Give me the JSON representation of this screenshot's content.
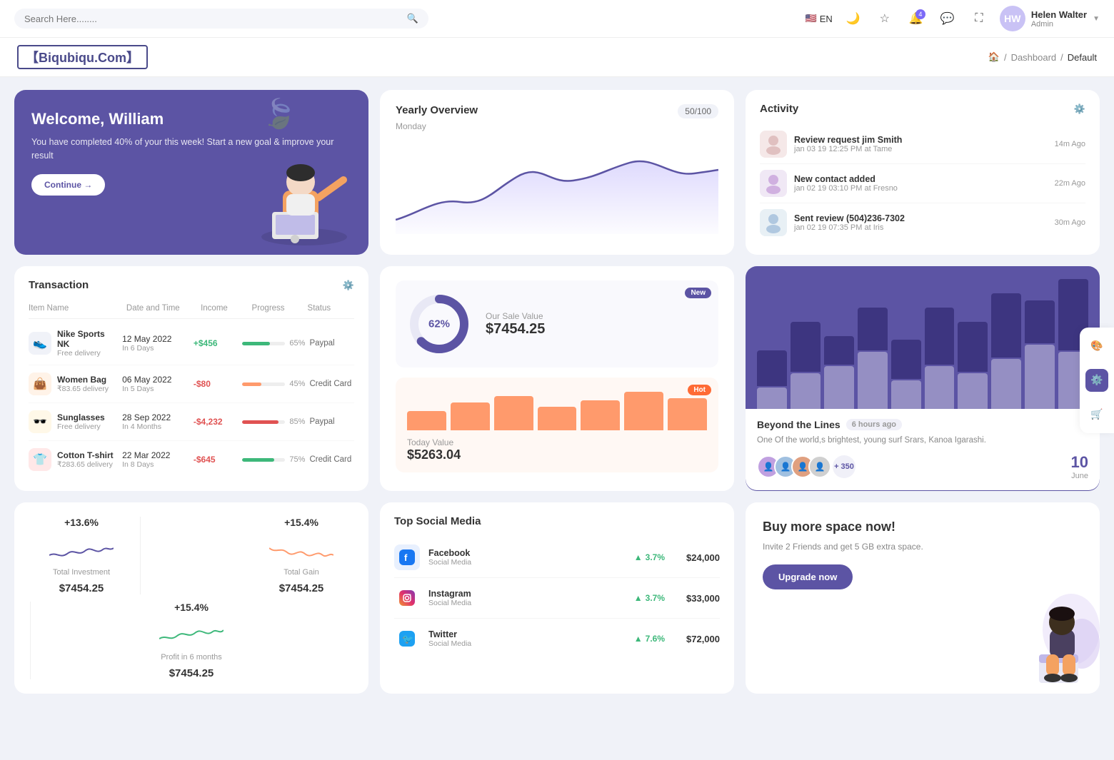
{
  "topnav": {
    "search_placeholder": "Search Here........",
    "lang": "EN",
    "user_name": "Helen Walter",
    "user_role": "Admin",
    "notification_count": "4"
  },
  "breadcrumb": {
    "brand": "【Biqubiqu.Com】",
    "home": "🏠",
    "dashboard": "Dashboard",
    "current": "Default"
  },
  "welcome": {
    "title": "Welcome, William",
    "subtitle": "You have completed 40% of your this week! Start a new goal & improve your result",
    "button": "Continue →"
  },
  "yearly": {
    "title": "Yearly Overview",
    "badge": "50/100",
    "subtitle": "Monday"
  },
  "activity": {
    "title": "Activity",
    "items": [
      {
        "name": "Review request jim Smith",
        "detail": "jan 03 19 12:25 PM at Tame",
        "ago": "14m Ago"
      },
      {
        "name": "New contact added",
        "detail": "jan 02 19 03:10 PM at Fresno",
        "ago": "22m Ago"
      },
      {
        "name": "Sent review (504)236-7302",
        "detail": "jan 02 19 07:35 PM at Iris",
        "ago": "30m Ago"
      }
    ]
  },
  "transaction": {
    "title": "Transaction",
    "headers": [
      "Item Name",
      "Date and Time",
      "Income",
      "Progress",
      "Status"
    ],
    "rows": [
      {
        "icon": "👟",
        "name": "Nike Sports NK",
        "sub": "Free delivery",
        "date": "12 May 2022",
        "date_sub": "In 6 Days",
        "income": "+$456",
        "income_type": "pos",
        "progress": 65,
        "progress_color": "#3db87a",
        "status": "Paypal"
      },
      {
        "icon": "👜",
        "name": "Women Bag",
        "sub": "₹83.65 delivery",
        "date": "06 May 2022",
        "date_sub": "In 5 Days",
        "income": "-$80",
        "income_type": "neg",
        "progress": 45,
        "progress_color": "#ff9a6c",
        "status": "Credit Card"
      },
      {
        "icon": "🕶️",
        "name": "Sunglasses",
        "sub": "Free delivery",
        "date": "28 Sep 2022",
        "date_sub": "In 4 Months",
        "income": "-$4,232",
        "income_type": "neg",
        "progress": 85,
        "progress_color": "#e05252",
        "status": "Paypal"
      },
      {
        "icon": "👕",
        "name": "Cotton T-shirt",
        "sub": "₹283.65 delivery",
        "date": "22 Mar 2022",
        "date_sub": "In 8 Days",
        "income": "-$645",
        "income_type": "neg",
        "progress": 75,
        "progress_color": "#3db87a",
        "status": "Credit Card"
      }
    ]
  },
  "sale_value": {
    "donut_pct": "62%",
    "label": "Our Sale Value",
    "value": "$7454.25",
    "badge": "New",
    "today_label": "Today Value",
    "today_value": "$5263.04",
    "hot_badge": "Hot",
    "today_bars": [
      30,
      45,
      55,
      40,
      50,
      60,
      50
    ]
  },
  "bar_chart": {
    "title": "Beyond the Lines",
    "time_ago": "6 hours ago",
    "desc": "One Of the world,s brightest, young surf Srars, Kanoa Igarashi.",
    "plus_count": "+ 350",
    "date_num": "10",
    "date_month": "June",
    "bars": [
      {
        "dark": 50,
        "light": 30
      },
      {
        "dark": 70,
        "light": 50
      },
      {
        "dark": 40,
        "light": 60
      },
      {
        "dark": 60,
        "light": 80
      },
      {
        "dark": 55,
        "light": 40
      },
      {
        "dark": 80,
        "light": 60
      },
      {
        "dark": 70,
        "light": 50
      },
      {
        "dark": 90,
        "light": 70
      },
      {
        "dark": 60,
        "light": 90
      },
      {
        "dark": 100,
        "light": 80
      }
    ]
  },
  "stats": {
    "items": [
      {
        "pct": "+13.6%",
        "label": "Total Investment",
        "value": "$7454.25",
        "color": "#5c54a4"
      },
      {
        "pct": "+15.4%",
        "label": "Total Gain",
        "value": "$7454.25",
        "color": "#ff9a6c"
      },
      {
        "pct": "+15.4%",
        "label": "Profit in 6 months",
        "value": "$7454.25",
        "color": "#3db87a"
      }
    ]
  },
  "social": {
    "title": "Top Social Media",
    "items": [
      {
        "icon": "📘",
        "name": "Facebook",
        "type": "Social Media",
        "growth": "3.7%",
        "amount": "$24,000",
        "color": "#1877f2"
      },
      {
        "icon": "📷",
        "name": "Instagram",
        "type": "Social Media",
        "growth": "3.7%",
        "amount": "$33,000",
        "color": "#e1306c"
      },
      {
        "icon": "🐦",
        "name": "Twitter",
        "type": "Social Media",
        "growth": "7.6%",
        "amount": "$72,000",
        "color": "#1da1f2"
      }
    ]
  },
  "buy_space": {
    "title": "Buy more space now!",
    "desc": "Invite 2 Friends and get 5 GB extra space.",
    "button": "Upgrade now"
  }
}
